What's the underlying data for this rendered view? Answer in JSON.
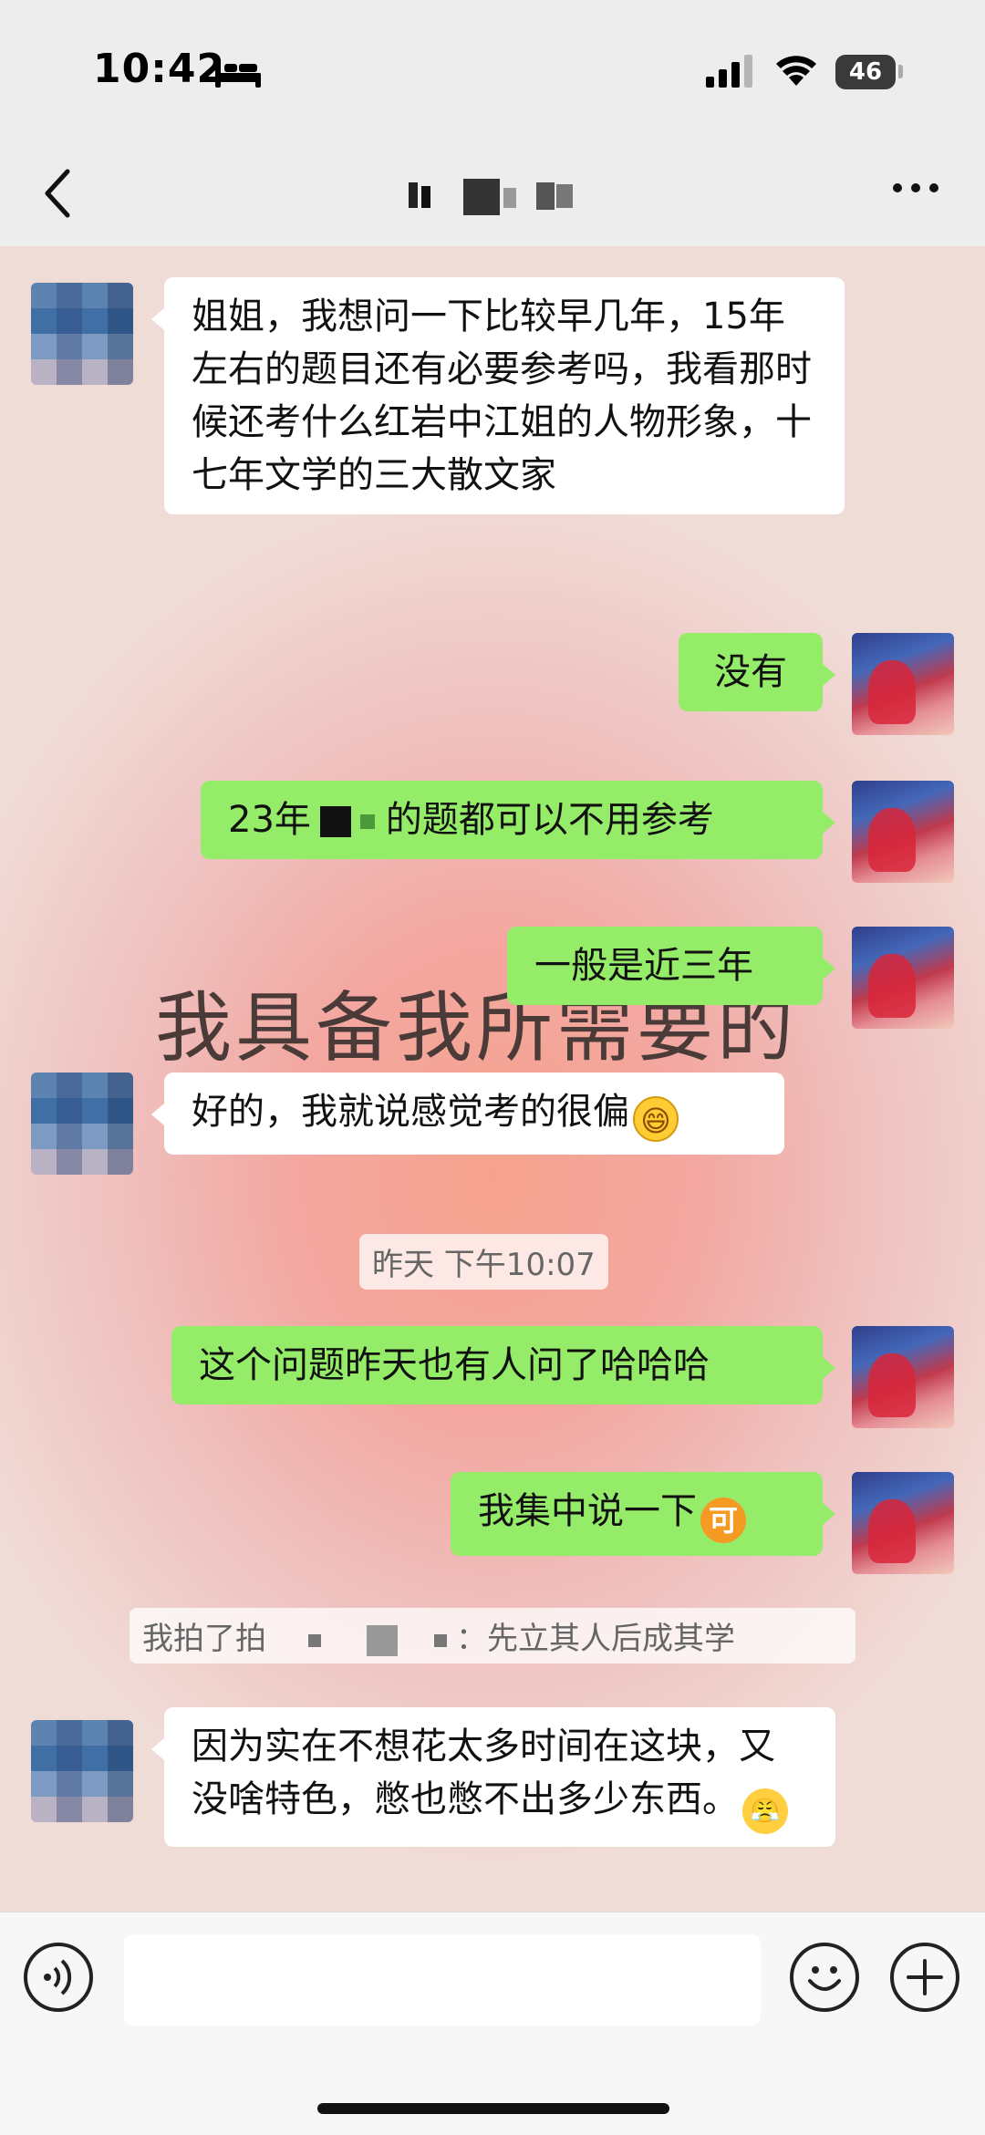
{
  "status_bar": {
    "time": "10:42",
    "battery": "46"
  },
  "header": {
    "title": ""
  },
  "overlay_text": "我具备我所需要的",
  "messages": [
    {
      "side": "left",
      "text": "姐姐，我想问一下比较早几年，15年左右的题目还有必要参考吗，我看那时候还考什么红岩中江姐的人物形象，十七年文学的三大散文家"
    },
    {
      "side": "right",
      "text": "没有"
    },
    {
      "side": "right",
      "text_before": "23年",
      "text_after": "的题都可以不用参考"
    },
    {
      "side": "right",
      "text": "一般是近三年"
    },
    {
      "side": "left",
      "text": "好的，我就说感觉考的很偏",
      "emoji": "grinning-face-emoji"
    },
    {
      "side": "right",
      "text": "这个问题昨天也有人问了哈哈哈"
    },
    {
      "side": "right",
      "text": "我集中说一下",
      "emoji": "ke-emoji"
    },
    {
      "side": "left",
      "text": "因为实在不想花太多时间在这块，又没啥特色，憋也憋不出多少东西。",
      "emoji": "sweat-emoji"
    }
  ],
  "timestamp": "昨天 下午10:07",
  "pat_notice": {
    "before": "我拍了拍",
    "after": "：先立其人后成其学"
  },
  "emoji_glyphs": {
    "grin": "😄",
    "ke": "可",
    "sweat": "😤"
  },
  "colors": {
    "sent_bubble": "#95ec69",
    "received_bubble": "#ffffff",
    "bar": "#ededed"
  }
}
